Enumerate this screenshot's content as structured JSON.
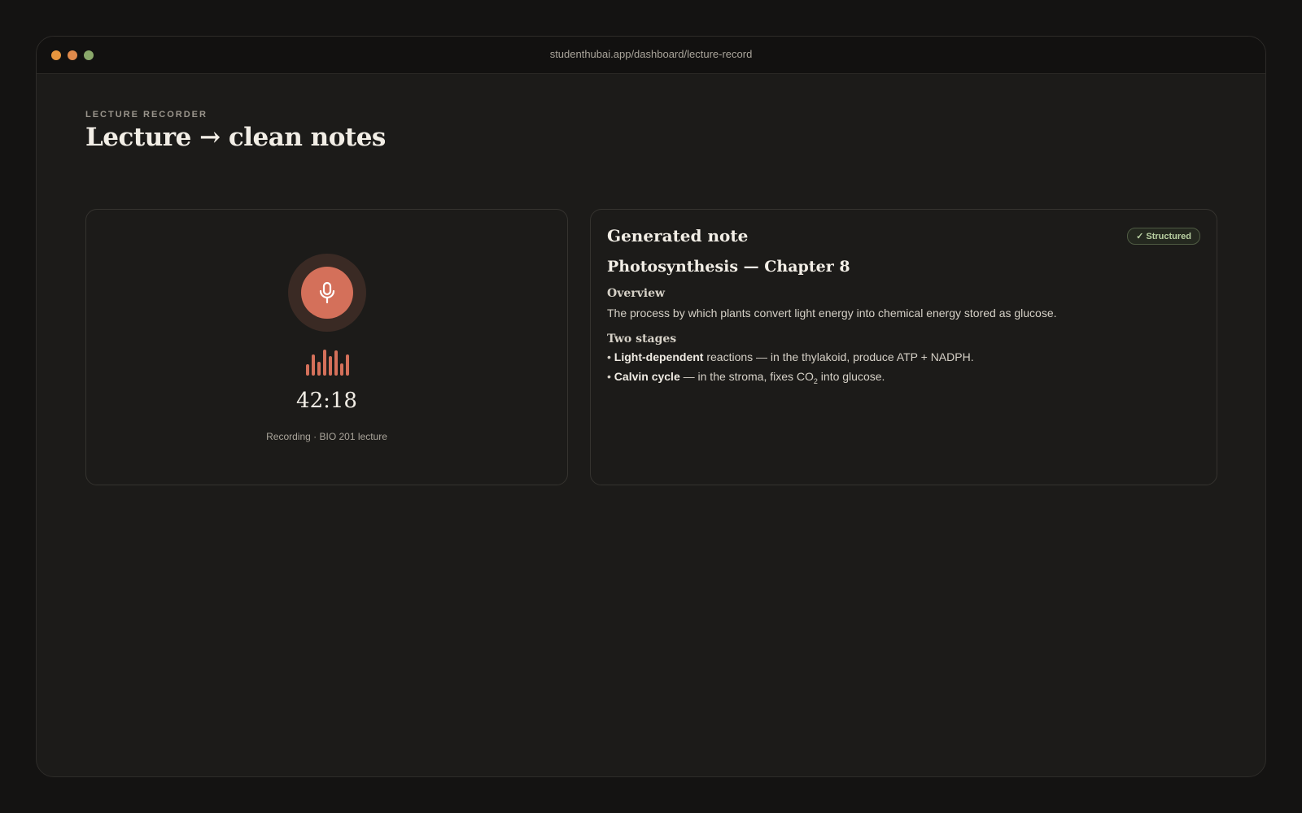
{
  "window": {
    "url": "studenthubai.app/dashboard/lecture-record",
    "dots": [
      "#e8963e",
      "#e08a4b",
      "#8aa86a"
    ]
  },
  "page": {
    "eyebrow": "LECTURE RECORDER",
    "title": "Lecture → clean notes"
  },
  "recorder": {
    "icon": "microphone-icon",
    "timer": "42:18",
    "status": "Recording · BIO 201 lecture",
    "waveform_levels": [
      0.4,
      0.75,
      0.5,
      0.95,
      0.7,
      0.9,
      0.45,
      0.75
    ]
  },
  "note": {
    "heading": "Generated note",
    "badge": "✓ Structured",
    "title": "Photosynthesis — Chapter 8",
    "overview_heading": "Overview",
    "overview_text": "The process by which plants convert light energy into chemical energy stored as glucose.",
    "stages_heading": "Two stages",
    "stages": [
      {
        "bold": "Light-dependent",
        "text": " reactions — in the thylakoid, produce ATP + NADPH."
      },
      {
        "bold": "Calvin cycle",
        "text_before": " — in the stroma, fixes CO",
        "subscript": "2",
        "text_after": " into glucose."
      }
    ]
  },
  "colors": {
    "accent": "#d4705a",
    "badge_text": "#b9d0a2"
  }
}
